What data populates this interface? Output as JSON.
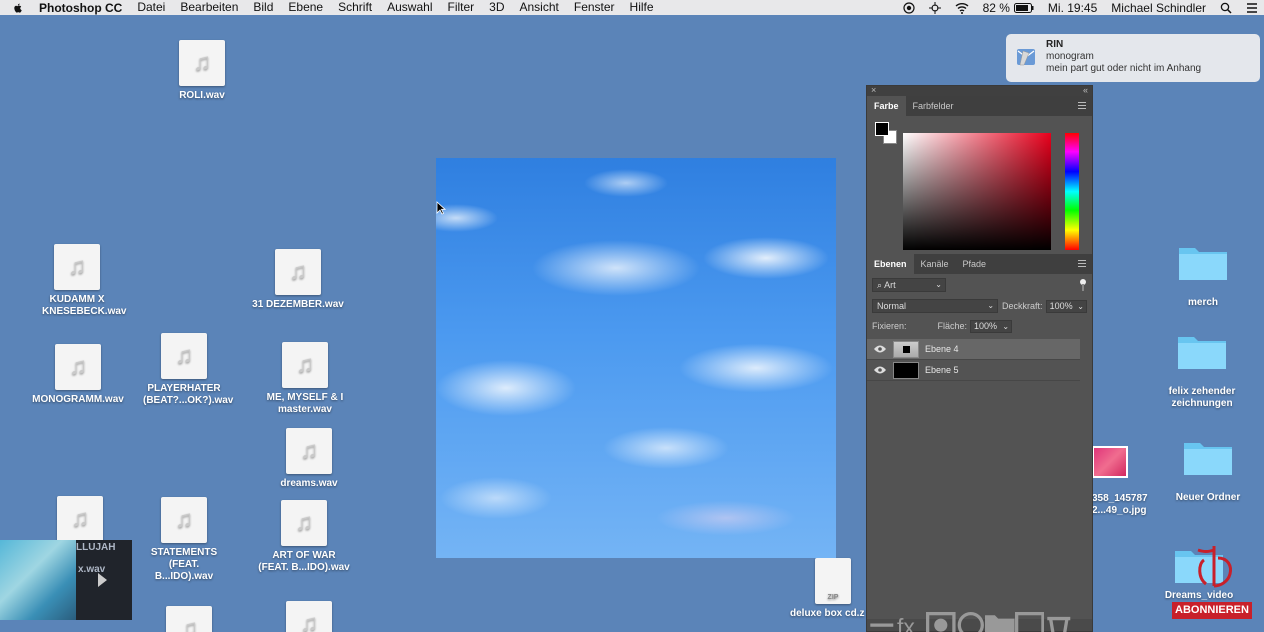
{
  "menubar": {
    "app_name": "Photoshop CC",
    "menus": [
      "Datei",
      "Bearbeiten",
      "Bild",
      "Ebene",
      "Schrift",
      "Auswahl",
      "Filter",
      "3D",
      "Ansicht",
      "Fenster",
      "Hilfe"
    ],
    "battery": "82 %",
    "clock": "Mi. 19:45",
    "user": "Michael Schindler"
  },
  "desktop": {
    "files": [
      {
        "label": "ROLI.wav"
      },
      {
        "label": "KUDAMM X KNESEBECK.wav"
      },
      {
        "label": "31 DEZEMBER.wav"
      },
      {
        "label": "MONOGRAMM.wav"
      },
      {
        "label": "PLAYERHATER (BEAT?...OK?).wav"
      },
      {
        "label": "ME, MYSELF & I master.wav"
      },
      {
        "label": "dreams.wav"
      },
      {
        "label": "STATEMENTS (FEAT. B...IDO).wav"
      },
      {
        "label": "ART OF WAR (FEAT. B...IDO).wav"
      }
    ],
    "partial_labels": {
      "hallujah": "LLUJAH",
      "hallujah2": "x.wav",
      "jpg_line1": "358_145787",
      "jpg_line2": "2...49_o.jpg",
      "zip": "deluxe box cd.z",
      "zip_badge": "ZIP",
      "dreams_video": "Dreams_video"
    },
    "folders": [
      {
        "label": "merch"
      },
      {
        "label": "felix zehender zeichnungen"
      },
      {
        "label": "Neuer Ordner"
      }
    ]
  },
  "notification": {
    "title": "RIN",
    "subtitle": "monogram",
    "message": "mein part gut oder nicht im Anhang"
  },
  "photoshop": {
    "color_tabs": [
      "Farbe",
      "Farbfelder"
    ],
    "layer_tabs": [
      "Ebenen",
      "Kanäle",
      "Pfade"
    ],
    "filter_select": "Art",
    "blend_mode": "Normal",
    "opacity_label": "Deckkraft:",
    "opacity_value": "100%",
    "lock_label": "Fixieren:",
    "fill_label": "Fläche:",
    "fill_value": "100%",
    "layers": [
      {
        "name": "Ebene 4",
        "selected": true
      },
      {
        "name": "Ebene 5",
        "selected": false
      }
    ]
  },
  "overlay": {
    "subscribe": "ABONNIEREN"
  },
  "colors": {
    "desktop": "#5b84b8",
    "ps_panel": "#535353",
    "subscribe_red": "#c8202a"
  }
}
